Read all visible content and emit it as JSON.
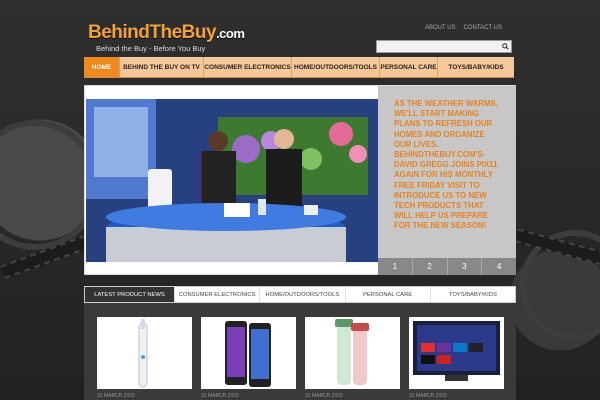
{
  "header": {
    "logo_text": "BehindTheBuy",
    "logo_suffix": ".com",
    "tagline": "Behind the Buy - Before You Buy",
    "top_links": [
      "ABOUT US",
      "CONTACT US"
    ],
    "search_placeholder": ""
  },
  "nav": {
    "items": [
      "HOME",
      "BEHIND THE BUY ON TV",
      "CONSUMER ELECTRONICS",
      "HOME/OUTDOORS/TOOLS",
      "PERSONAL CARE",
      "TOYS/BABY/KIDS"
    ],
    "active_index": 0
  },
  "slider": {
    "caption": "AS THE WEATHER WARMS, WE'LL START MAKING PLANS TO REFRESH OUR HOMES AND ORGANIZE OUR LIVES. BEHINDTHEBUY.COM'S- DAVID GREGG JOINS PIX11 AGAIN FOR HIS MONTHLY FREE FRIDAY VISIT TO INTRODUCE US TO NEW TECH PRODUCTS THAT WILL HELP US PREPARE FOR THE NEW SEASON!",
    "pages": [
      "1",
      "2",
      "3",
      "4"
    ]
  },
  "news_tabs": {
    "items": [
      "LATEST PRODUCT NEWS",
      "CONSUMER ELECTRONICS",
      "HOME/OUTDOORS/TOOLS",
      "PERSONAL CARE",
      "TOYS/BABY/KIDS"
    ],
    "active_index": 0
  },
  "products": [
    {
      "name": "electric-toothbrush",
      "date": "31 MARCH 2015"
    },
    {
      "name": "smartphones",
      "date": "31 MARCH 2015"
    },
    {
      "name": "water-bottles",
      "date": "31 MARCH 2015"
    },
    {
      "name": "smart-tv",
      "date": "31 MARCH 2015"
    }
  ],
  "colors": {
    "accent": "#f08a1c",
    "nav_bg": "#f7c79a",
    "caption_text": "#e8821a"
  }
}
